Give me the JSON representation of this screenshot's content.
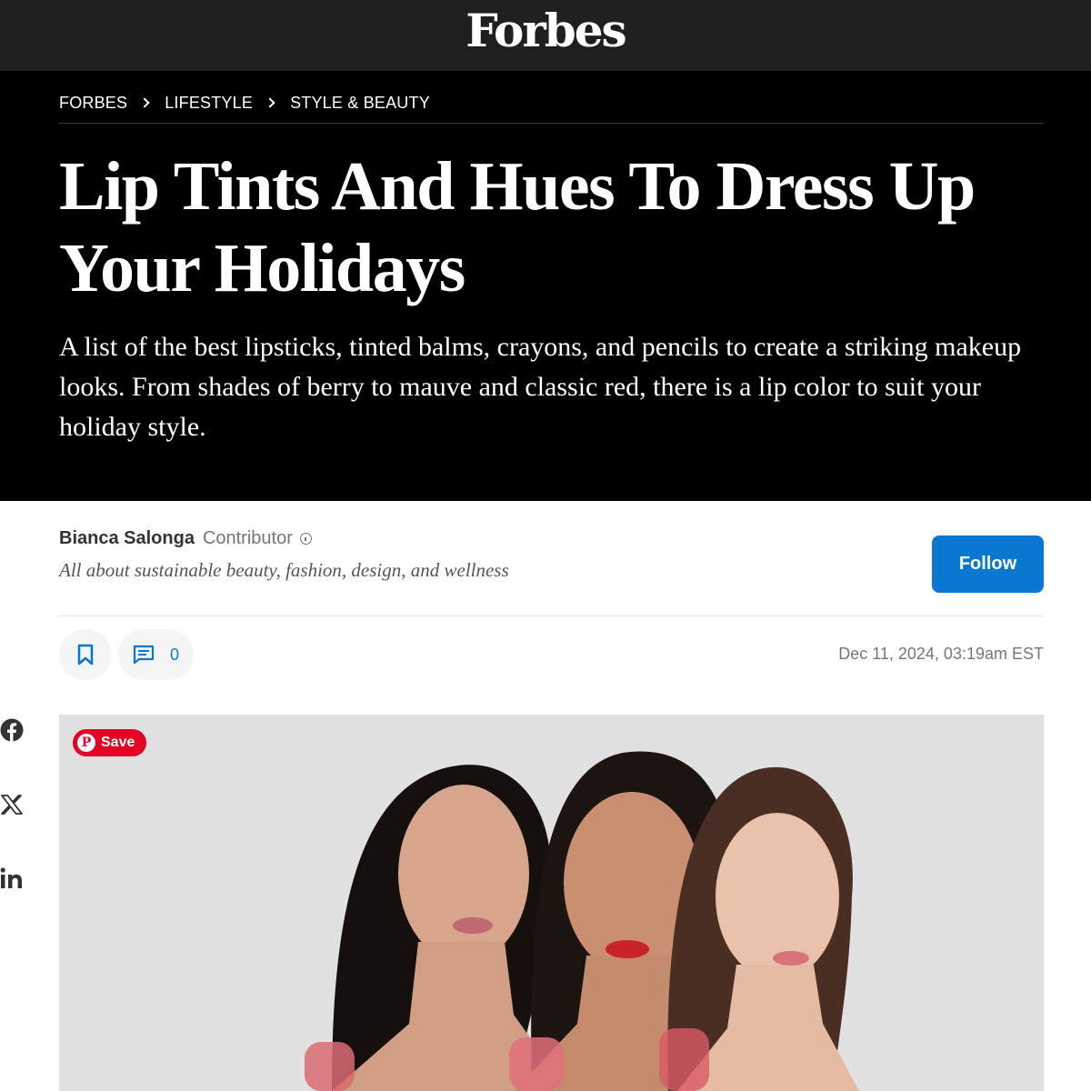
{
  "header": {
    "logo": "Forbes"
  },
  "breadcrumb": [
    "FORBES",
    "LIFESTYLE",
    "STYLE & BEAUTY"
  ],
  "article": {
    "title": "Lip Tints And Hues To Dress Up Your Holidays",
    "dek": "A list of the best lipsticks, tinted balms, crayons, and pencils to create a striking makeup looks. From shades of berry to mauve and classic red, there is a lip color to suit your holiday style."
  },
  "author": {
    "name": "Bianca Salonga",
    "role": "Contributor",
    "bio": "All about sustainable beauty, fashion, design, and wellness",
    "follow_label": "Follow"
  },
  "actions": {
    "comment_count": "0",
    "date": "Dec 11, 2024, 03:19am EST"
  },
  "social": [
    "facebook-icon",
    "x-icon",
    "linkedin-icon"
  ],
  "image": {
    "save_label": "Save"
  },
  "colors": {
    "header_bg": "#1f1f1f",
    "hero_bg": "#000000",
    "accent": "#0a78d1",
    "pinterest": "#e60023"
  }
}
